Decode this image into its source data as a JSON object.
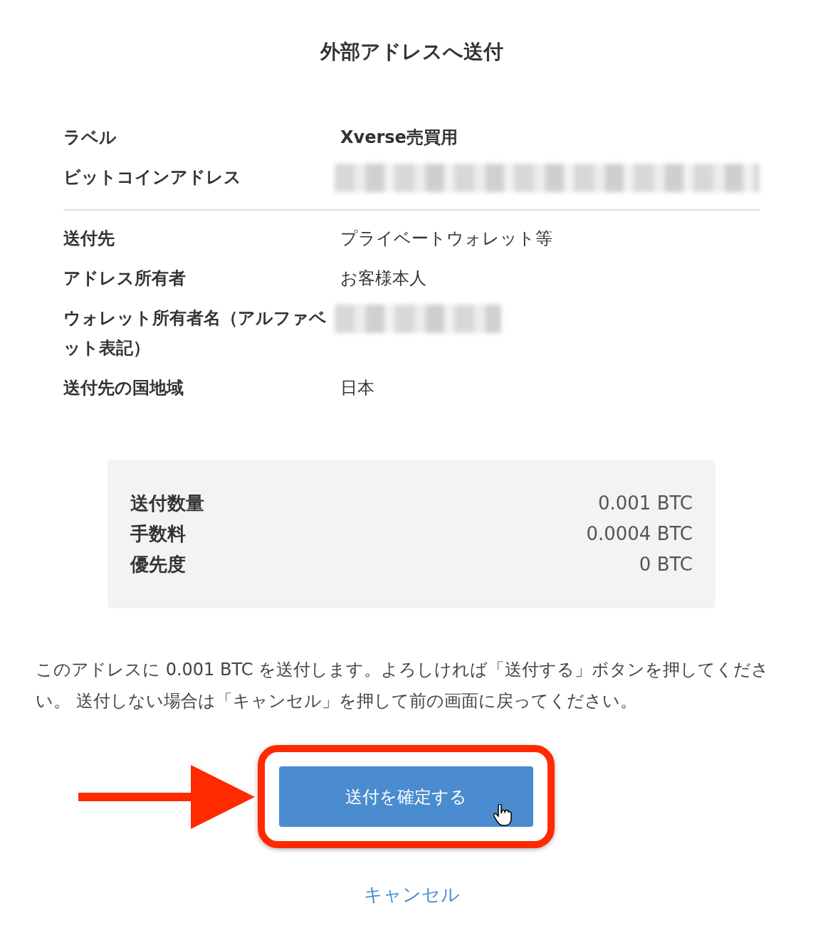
{
  "title": "外部アドレスへ送付",
  "details_top": [
    {
      "label": "ラベル",
      "value": "Xverse売買用",
      "kind": "bold"
    },
    {
      "label": "ビットコインアドレス",
      "kind": "redacted"
    }
  ],
  "details_bottom": [
    {
      "label": "送付先",
      "value": "プライベートウォレット等",
      "kind": "text"
    },
    {
      "label": "アドレス所有者",
      "value": "お客様本人",
      "kind": "text"
    },
    {
      "label": "ウォレット所有者名（アルファベット表記）",
      "kind": "redacted"
    },
    {
      "label": "送付先の国地域",
      "value": "日本",
      "kind": "text"
    }
  ],
  "summary": [
    {
      "label": "送付数量",
      "value": "0.001 BTC"
    },
    {
      "label": "手数料",
      "value": "0.0004 BTC"
    },
    {
      "label": "優先度",
      "value": "0 BTC"
    }
  ],
  "message": "このアドレスに 0.001 BTC を送付します。よろしければ「送付する」ボタンを押してください。 送付しない場合は「キャンセル」を押して前の画面に戻ってください。",
  "confirm_button": "送付を確定する",
  "cancel_link": "キャンセル"
}
